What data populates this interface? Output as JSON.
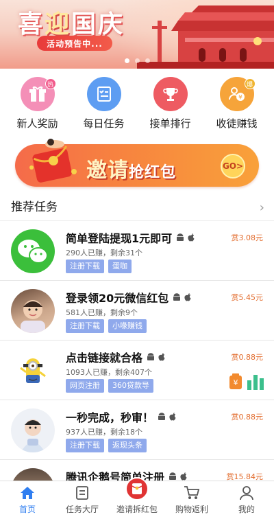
{
  "banner": {
    "title_part1": "喜",
    "title_highlight": "迎",
    "title_part2": "国庆",
    "cta": "活动预告中..."
  },
  "menu": [
    {
      "label": "新人奖励",
      "icon": "gift-icon",
      "badge": "热"
    },
    {
      "label": "每日任务",
      "icon": "checklist-icon"
    },
    {
      "label": "接单排行",
      "icon": "trophy-icon"
    },
    {
      "label": "收徒赚钱",
      "icon": "people-money-icon",
      "badge": "爆"
    }
  ],
  "invite": {
    "main": "邀请",
    "sub": "抢红包",
    "go": "GO>"
  },
  "section": {
    "title": "推荐任务",
    "more_glyph": "›"
  },
  "tasks": [
    {
      "title": "简单登陆提现1元即可",
      "meta": "290人已赚，剩余31个",
      "tags": [
        "注册下载",
        "蛋咖"
      ],
      "reward": "赏3.08元",
      "avatar": "wechat-icon"
    },
    {
      "title": "登录领20元微信红包",
      "meta": "581人已赚，剩余9个",
      "tags": [
        "注册下载",
        "小喙赚钱"
      ],
      "reward": "赏5.45元",
      "avatar": "child-photo"
    },
    {
      "title": "点击链接就合格",
      "meta": "1093人已赚，剩余407个",
      "tags": [
        "网页注册",
        "360贷款导"
      ],
      "reward": "赏0.88元",
      "avatar": "minion-avatar"
    },
    {
      "title": "一秒完成，秒审！",
      "meta": "937人已赚，剩余18个",
      "tags": [
        "注册下载",
        "返现头条"
      ],
      "reward": "赏0.88元",
      "avatar": "baby-photo"
    },
    {
      "title": "腾讯企鹅号简单注册",
      "meta": "",
      "tags": [],
      "reward": "赏15.84元",
      "avatar": "person-photo"
    }
  ],
  "nav": [
    {
      "label": "首页",
      "icon": "home-icon",
      "active": true
    },
    {
      "label": "任务大厅",
      "icon": "task-hall-icon"
    },
    {
      "label": "邀请拆红包",
      "icon": "red-envelope-icon"
    },
    {
      "label": "购物返利",
      "icon": "cart-icon"
    },
    {
      "label": "我的",
      "icon": "user-icon"
    }
  ],
  "colors": {
    "accent": "#2f7ef0",
    "reward": "#e26b2c",
    "tag": "#8fa9ec"
  }
}
